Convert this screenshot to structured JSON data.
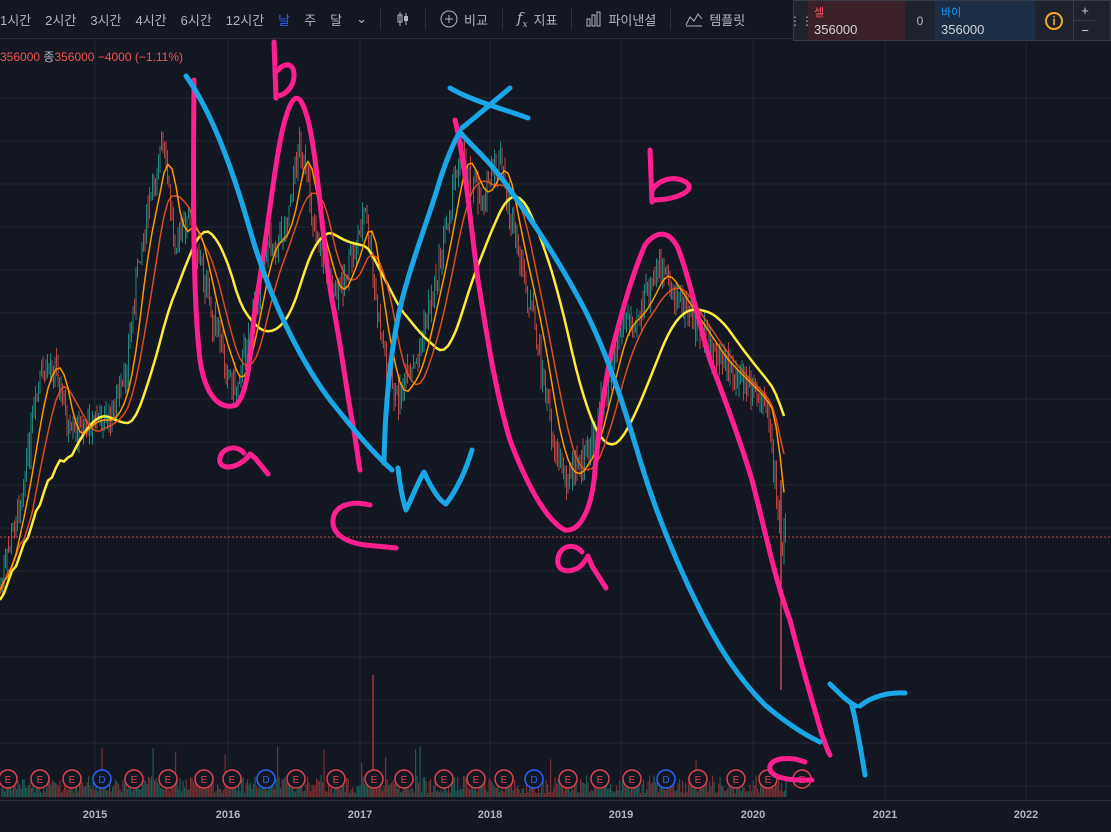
{
  "toolbar": {
    "intervals": [
      "1시간",
      "2시간",
      "3시간",
      "4시간",
      "6시간",
      "12시간",
      "날",
      "주",
      "달"
    ],
    "active_interval": "날",
    "candle_icon": "candlestick-icon",
    "compare_label": "비교",
    "indicators_label": "지표",
    "pine_editor_label": "파이낸셜",
    "templates_label": "템플릿"
  },
  "trade_panel": {
    "sell_label": "셀",
    "sell_price": "356000",
    "spread": "0",
    "buy_label": "바이",
    "buy_price": "356000",
    "plus": "+",
    "minus": "−"
  },
  "legend": {
    "open_value": "356000",
    "close_label": "종",
    "close_value": "356000",
    "change": "−4000",
    "change_pct": "(−1.11%)"
  },
  "x_axis": {
    "labels": [
      "2015",
      "2016",
      "2017",
      "2018",
      "2019",
      "2020",
      "2021",
      "2022"
    ]
  },
  "annotations": {
    "pink_letters": [
      "b",
      "a",
      "b",
      "a",
      "c",
      "c"
    ],
    "blue_letters": [
      "x",
      "w",
      "y"
    ]
  },
  "colors": {
    "background": "#131722",
    "grid": "#232734",
    "candle_up": "#26a69a",
    "candle_down": "#ef5350",
    "ma_yellow": "#ffeb3b",
    "ma_orange": "#ff9800",
    "ma_red": "#f4511e",
    "pen_pink": "#ff1f8e",
    "pen_blue": "#1aa7e8",
    "earnings_badge": "#e0424e"
  }
}
